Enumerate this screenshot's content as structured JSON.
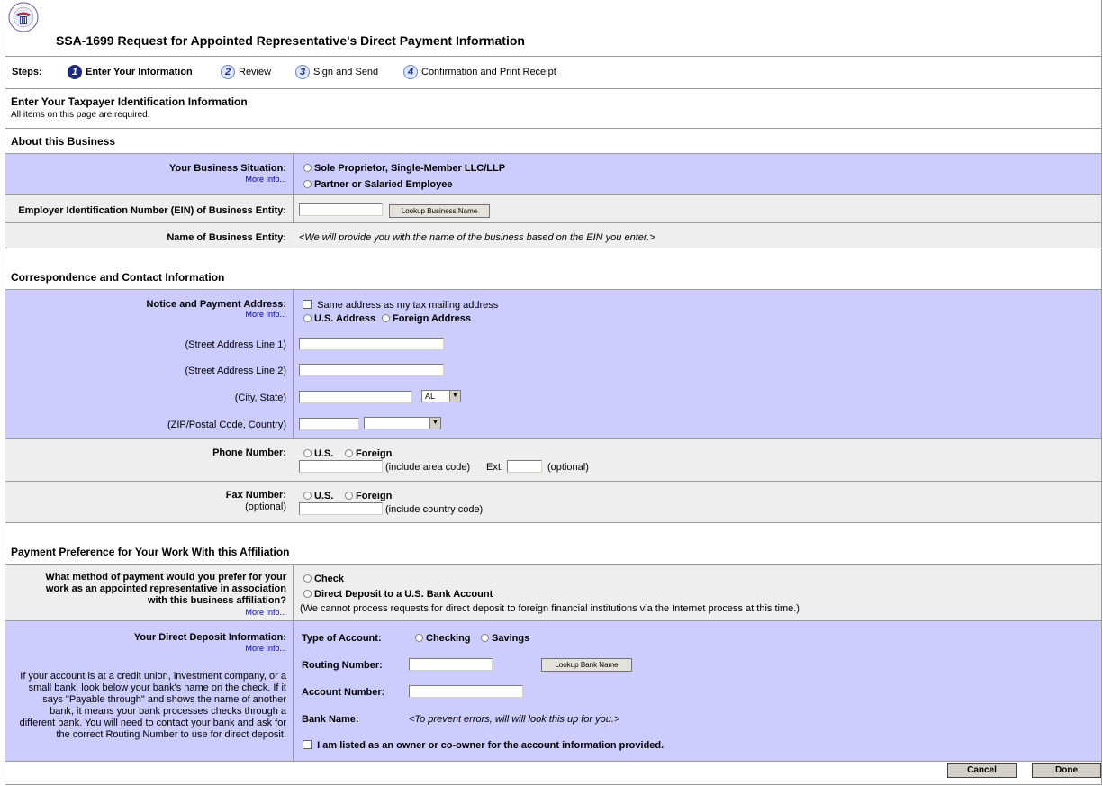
{
  "header": {
    "title": "SSA-1699 Request for Appointed Representative's Direct Payment Information",
    "seal_text": "SOCIAL SECURITY ADMINISTRATION USA"
  },
  "steps": {
    "label": "Steps:",
    "items": [
      {
        "num": "1",
        "label": "Enter Your Information"
      },
      {
        "num": "2",
        "label": "Review"
      },
      {
        "num": "3",
        "label": "Sign and Send"
      },
      {
        "num": "4",
        "label": "Confirmation and Print Receipt"
      }
    ]
  },
  "page": {
    "heading": "Enter Your Taxpayer Identification Information",
    "subheading": "All items on this page are required."
  },
  "business": {
    "section": "About this Business",
    "situation_label": "Your Business Situation:",
    "more_info": "More Info...",
    "opt_sole": "Sole Proprietor, Single-Member LLC/LLP",
    "opt_partner": "Partner or Salaried Employee",
    "ein_label": "Employer Identification Number (EIN) of Business Entity:",
    "ein_value": "",
    "lookup_business": "Lookup Business Name",
    "name_label": "Name of Business Entity:",
    "name_hint": "<We will provide you with the name of the business based on the EIN you enter.>"
  },
  "contact": {
    "section": "Correspondence and Contact Information",
    "address_label": "Notice and Payment Address:",
    "more_info": "More Info...",
    "same_address": "Same address as my tax mailing address",
    "opt_us": "U.S. Address",
    "opt_foreign": "Foreign Address",
    "street1_label": "(Street Address Line 1)",
    "street2_label": "(Street Address Line 2)",
    "city_label": "(City, State)",
    "state_value": "AL",
    "zip_label": "(ZIP/Postal Code, Country)",
    "country_value": "",
    "phone_label": "Phone Number:",
    "phone_us": "U.S.",
    "phone_foreign": "Foreign",
    "phone_hint": "(include area code)",
    "ext_label": "Ext:",
    "ext_optional": "(optional)",
    "fax_label": "Fax Number:",
    "fax_optional": "(optional)",
    "fax_us": "U.S.",
    "fax_foreign": "Foreign",
    "fax_hint": "(include country code)"
  },
  "payment": {
    "section": "Payment Preference for Your Work With this Affiliation",
    "question_line1": "What method of payment would you prefer for your",
    "question_line2": "work as an appointed representative in association",
    "question_line3": "with this business affiliation?",
    "more_info": "More Info...",
    "opt_check": "Check",
    "opt_direct": "Direct Deposit to a U.S. Bank Account",
    "note": "(We cannot process requests for direct deposit to foreign financial institutions via the Internet process at this time.)"
  },
  "deposit": {
    "label": "Your Direct Deposit Information:",
    "more_info": "More Info...",
    "help_lines": [
      "If your account is at a credit union, investment company, or a",
      "small bank, look below your bank's name on the check. If it",
      "says \"Payable through\" and shows the name of another",
      "bank, it means your bank processes checks through a",
      "different bank. You will need to contact your bank and ask for",
      "the correct Routing Number to use for direct deposit."
    ],
    "type_label": "Type of Account:",
    "opt_checking": "Checking",
    "opt_savings": "Savings",
    "routing_label": "Routing Number:",
    "lookup_bank": "Lookup Bank Name",
    "account_label": "Account Number:",
    "bank_label": "Bank Name:",
    "bank_hint": "<To prevent errors, will will look this up for you.>",
    "owner_text": "I am listed as an owner or co-owner for the account information provided."
  },
  "footer": {
    "cancel": "Cancel",
    "done": "Done"
  }
}
